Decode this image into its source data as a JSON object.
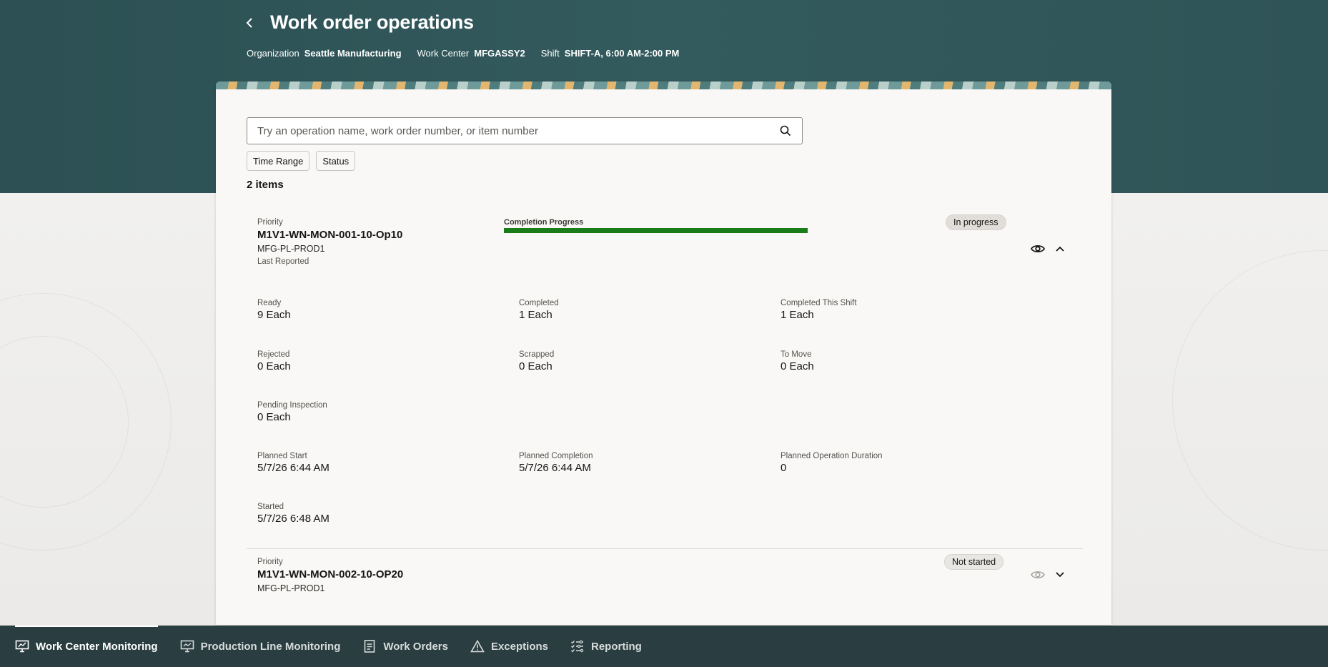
{
  "header": {
    "title": "Work order operations",
    "context": [
      {
        "label": "Organization",
        "value": "Seattle Manufacturing"
      },
      {
        "label": "Work Center",
        "value": "MFGASSY2"
      },
      {
        "label": "Shift",
        "value": "SHIFT-A, 6:00 AM-2:00 PM"
      }
    ]
  },
  "search": {
    "placeholder": "Try an operation name, work order number, or item number",
    "value": ""
  },
  "filters": {
    "time_range": "Time Range",
    "status": "Status"
  },
  "items_count": "2 items",
  "operations": [
    {
      "priority_label": "Priority",
      "name": "M1V1-WN-MON-001-10-Op10",
      "line": "MFG-PL-PROD1",
      "last_reported_label": "Last Reported",
      "progress_label": "Completion Progress",
      "progress_percent": 100,
      "status": "In progress",
      "expanded": true,
      "fields": {
        "ready": {
          "label": "Ready",
          "value": "9 Each"
        },
        "completed": {
          "label": "Completed",
          "value": "1 Each"
        },
        "completed_shift": {
          "label": "Completed This Shift",
          "value": "1 Each"
        },
        "rejected": {
          "label": "Rejected",
          "value": "0 Each"
        },
        "scrapped": {
          "label": "Scrapped",
          "value": "0 Each"
        },
        "to_move": {
          "label": "To Move",
          "value": "0 Each"
        },
        "pending_inspection": {
          "label": "Pending Inspection",
          "value": "0 Each"
        },
        "planned_start": {
          "label": "Planned Start",
          "value": "5/7/26 6:44 AM"
        },
        "planned_completion": {
          "label": "Planned Completion",
          "value": "5/7/26 6:44 AM"
        },
        "planned_duration": {
          "label": "Planned Operation Duration",
          "value": "0"
        },
        "started": {
          "label": "Started",
          "value": "5/7/26 6:48 AM"
        }
      }
    },
    {
      "priority_label": "Priority",
      "name": "M1V1-WN-MON-002-10-OP20",
      "line": "MFG-PL-PROD1",
      "status": "Not started",
      "expanded": false
    }
  ],
  "bottom_nav": [
    {
      "label": "Work Center Monitoring",
      "icon": "monitor-icon",
      "active": true
    },
    {
      "label": "Production Line Monitoring",
      "icon": "line-monitor-icon",
      "active": false
    },
    {
      "label": "Work Orders",
      "icon": "document-icon",
      "active": false
    },
    {
      "label": "Exceptions",
      "icon": "warning-icon",
      "active": false
    },
    {
      "label": "Reporting",
      "icon": "checklist-icon",
      "active": false
    }
  ],
  "colors": {
    "header": "#2f5457",
    "progress": "#1a7d1a",
    "nav": "#2a3d40"
  }
}
